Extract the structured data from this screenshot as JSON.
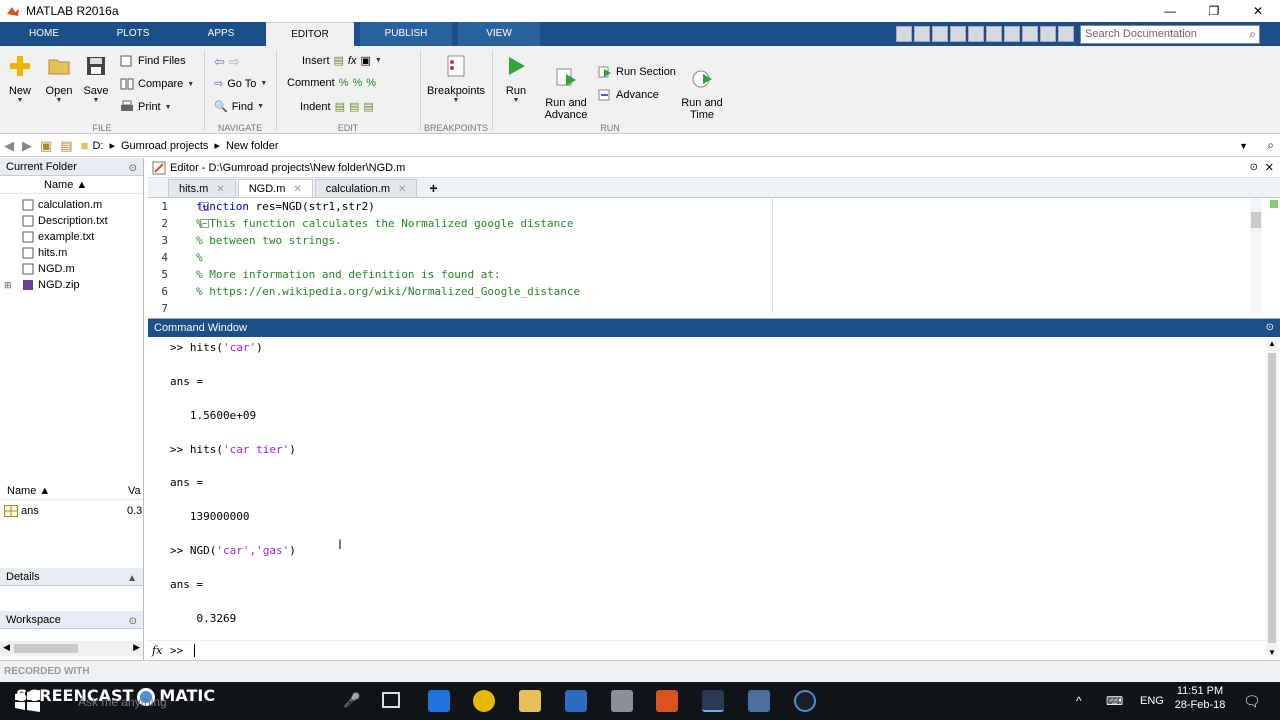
{
  "window": {
    "title": "MATLAB R2016a",
    "minimize": "—",
    "restore": "❐",
    "close": "✕"
  },
  "ribbon_tabs": [
    "HOME",
    "PLOTS",
    "APPS",
    "EDITOR",
    "PUBLISH",
    "VIEW"
  ],
  "search": {
    "placeholder": "Search Documentation"
  },
  "ribbon": {
    "file": {
      "label": "FILE",
      "new": "New",
      "open": "Open",
      "save": "Save",
      "find_files": "Find Files",
      "compare": "Compare",
      "print": "Print"
    },
    "navigate": {
      "label": "NAVIGATE",
      "go_to": "Go To",
      "find": "Find"
    },
    "edit": {
      "label": "EDIT",
      "insert": "Insert",
      "comment": "Comment",
      "indent": "Indent"
    },
    "breakpoints": {
      "label": "BREAKPOINTS",
      "breakpoints": "Breakpoints"
    },
    "run": {
      "label": "RUN",
      "run": "Run",
      "run_advance": "Run and\nAdvance",
      "run_section": "Run Section",
      "advance": "Advance",
      "run_time": "Run and\nTime"
    }
  },
  "address": {
    "drive": "D:",
    "folder1": "Gumroad projects",
    "folder2": "New folder"
  },
  "current_folder": {
    "title": "Current Folder",
    "name_col": "Name ▲",
    "files": [
      "calculation.m",
      "Description.txt",
      "example.txt",
      "hits.m",
      "NGD.m",
      "NGD.zip"
    ]
  },
  "details": {
    "title": "Details"
  },
  "workspace": {
    "title": "Workspace",
    "name_col": "Name ▲",
    "value_col": "Va",
    "var_name": "ans",
    "var_value": "0.3"
  },
  "editor": {
    "title": "Editor - D:\\Gumroad projects\\New folder\\NGD.m",
    "tabs": [
      "hits.m",
      "NGD.m",
      "calculation.m"
    ],
    "lines": [
      {
        "n": "1",
        "kw": "function",
        "rest": " res=NGD(str1,str2)"
      },
      {
        "n": "2",
        "cm": "% This function calculates the Normalized google distance"
      },
      {
        "n": "3",
        "cm": "% between two strings."
      },
      {
        "n": "4",
        "cm": "%"
      },
      {
        "n": "5",
        "cm": "% More information and definition is found at:"
      },
      {
        "n": "6",
        "cm": "% https://en.wikipedia.org/wiki/Normalized_Google_distance"
      },
      {
        "n": "7",
        "cm": ""
      }
    ]
  },
  "command_window": {
    "title": "Command Window",
    "lines": [
      {
        "prompt": ">> hits(",
        "str": "'car'",
        "end": ")"
      },
      {
        "text": "ans ="
      },
      {
        "text": "   1.5600e+09"
      },
      {
        "prompt": ">> hits(",
        "str": "'car tier'",
        "end": ")"
      },
      {
        "text": "ans ="
      },
      {
        "text": "   139000000"
      },
      {
        "prompt": ">> NGD(",
        "str": "'car','gas'",
        "end": ")"
      },
      {
        "text": "ans ="
      },
      {
        "text": "    0.3269"
      }
    ],
    "fx": "fx",
    "current_prompt": ">>"
  },
  "watermark": {
    "recorded": "RECORDED WITH",
    "brand": "SCREENCAST",
    "brand2": "MATIC",
    "search_hint": "Ask me anything"
  },
  "tray": {
    "lang": "ENG",
    "time": "11:51 PM",
    "date": "28-Feb-18"
  }
}
